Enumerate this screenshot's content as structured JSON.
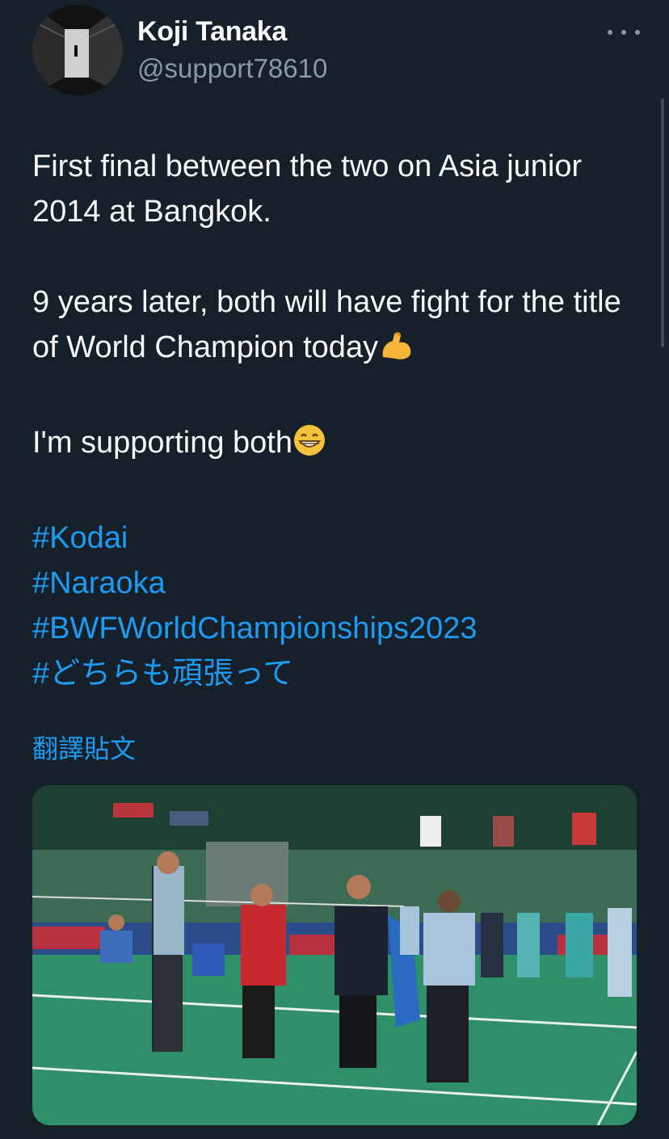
{
  "author": {
    "name": "Koji Tanaka",
    "handle": "@support78610",
    "avatar_icon": "avatar-photo-corridor"
  },
  "more_icon": "ellipsis-icon",
  "tweet": {
    "line1": "First final between the two on Asia junior 2014 at Bangkok.",
    "line2": "9 years later, both will have fight for the title of World Champion today",
    "line2_emoji": "flexed-biceps-emoji",
    "line3": "I'm supporting both",
    "line3_emoji": "grinning-face-emoji",
    "hashtags": [
      "#Kodai",
      "#Naraoka",
      "#BWFWorldChampionships2023",
      "#どちらも頑張って"
    ]
  },
  "translate_label": "翻譯貼文",
  "media": {
    "type": "photo",
    "description_icon": "badminton-court-photo"
  },
  "colors": {
    "background": "#15202b",
    "text": "#f7f9f9",
    "secondary": "#8b98a5",
    "link": "#1d9bf0"
  }
}
